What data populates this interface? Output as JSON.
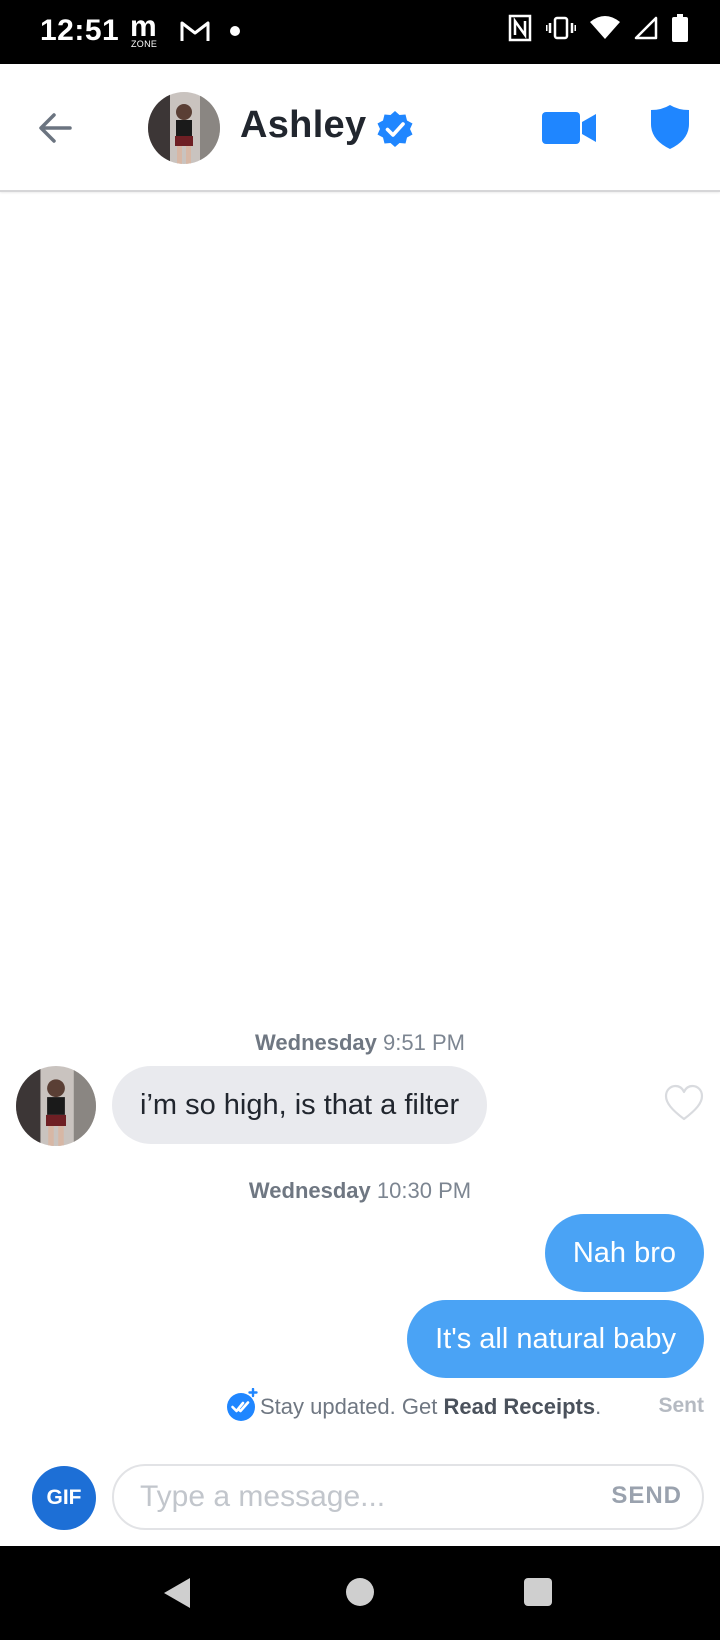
{
  "status_bar": {
    "time": "12:51",
    "mzone_letter": "m",
    "mzone_label": "ZONE"
  },
  "header": {
    "contact_name": "Ashley",
    "verified": true
  },
  "chat": {
    "messages": [
      {
        "timestamp_day": "Wednesday",
        "timestamp_time": "9:51 PM"
      },
      {
        "direction": "received",
        "text": "i’m so high, is that a filter"
      },
      {
        "timestamp_day": "Wednesday",
        "timestamp_time": "10:30 PM"
      },
      {
        "direction": "sent",
        "text": "Nah bro"
      },
      {
        "direction": "sent",
        "text": "It's all natural baby"
      }
    ],
    "receipts_prompt": {
      "prefix": "Stay updated. Get ",
      "link": "Read Receipts",
      "suffix": "."
    },
    "status": "Sent"
  },
  "composer": {
    "gif_label": "GIF",
    "placeholder": "Type a message...",
    "value": "",
    "send_label": "SEND"
  },
  "colors": {
    "accent": "#4aa3f5",
    "brand_blue": "#1d6fd6",
    "received_bubble": "#e9eaee"
  }
}
